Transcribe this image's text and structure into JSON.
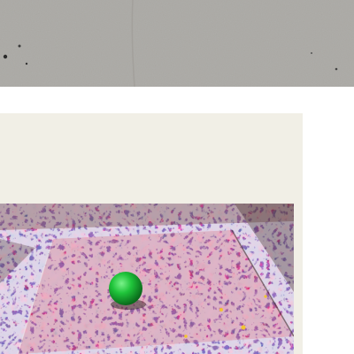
{
  "scene": {
    "regions": [
      "concrete-floor",
      "white-strip",
      "cream-panel",
      "splatter-painting"
    ],
    "colors": {
      "concrete": "#a9a7a2",
      "panel": "#f1efe6",
      "sphere": "#1fc43a",
      "splatter_red": "#d3242a",
      "splatter_blue": "#2c3f9c",
      "splatter_yellow": "#f0c531",
      "splatter_white": "#f3f1ee"
    },
    "objects": [
      "green-sphere"
    ]
  }
}
